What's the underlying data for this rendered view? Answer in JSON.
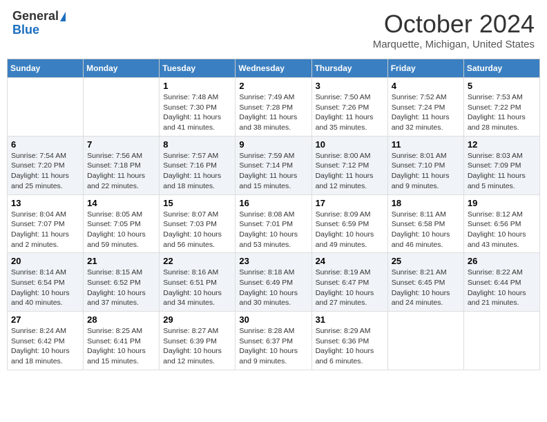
{
  "header": {
    "logo_general": "General",
    "logo_blue": "Blue",
    "month_title": "October 2024",
    "location": "Marquette, Michigan, United States"
  },
  "days_of_week": [
    "Sunday",
    "Monday",
    "Tuesday",
    "Wednesday",
    "Thursday",
    "Friday",
    "Saturday"
  ],
  "weeks": [
    [
      {
        "day": "",
        "info": ""
      },
      {
        "day": "",
        "info": ""
      },
      {
        "day": "1",
        "info": "Sunrise: 7:48 AM\nSunset: 7:30 PM\nDaylight: 11 hours and 41 minutes."
      },
      {
        "day": "2",
        "info": "Sunrise: 7:49 AM\nSunset: 7:28 PM\nDaylight: 11 hours and 38 minutes."
      },
      {
        "day": "3",
        "info": "Sunrise: 7:50 AM\nSunset: 7:26 PM\nDaylight: 11 hours and 35 minutes."
      },
      {
        "day": "4",
        "info": "Sunrise: 7:52 AM\nSunset: 7:24 PM\nDaylight: 11 hours and 32 minutes."
      },
      {
        "day": "5",
        "info": "Sunrise: 7:53 AM\nSunset: 7:22 PM\nDaylight: 11 hours and 28 minutes."
      }
    ],
    [
      {
        "day": "6",
        "info": "Sunrise: 7:54 AM\nSunset: 7:20 PM\nDaylight: 11 hours and 25 minutes."
      },
      {
        "day": "7",
        "info": "Sunrise: 7:56 AM\nSunset: 7:18 PM\nDaylight: 11 hours and 22 minutes."
      },
      {
        "day": "8",
        "info": "Sunrise: 7:57 AM\nSunset: 7:16 PM\nDaylight: 11 hours and 18 minutes."
      },
      {
        "day": "9",
        "info": "Sunrise: 7:59 AM\nSunset: 7:14 PM\nDaylight: 11 hours and 15 minutes."
      },
      {
        "day": "10",
        "info": "Sunrise: 8:00 AM\nSunset: 7:12 PM\nDaylight: 11 hours and 12 minutes."
      },
      {
        "day": "11",
        "info": "Sunrise: 8:01 AM\nSunset: 7:10 PM\nDaylight: 11 hours and 9 minutes."
      },
      {
        "day": "12",
        "info": "Sunrise: 8:03 AM\nSunset: 7:09 PM\nDaylight: 11 hours and 5 minutes."
      }
    ],
    [
      {
        "day": "13",
        "info": "Sunrise: 8:04 AM\nSunset: 7:07 PM\nDaylight: 11 hours and 2 minutes."
      },
      {
        "day": "14",
        "info": "Sunrise: 8:05 AM\nSunset: 7:05 PM\nDaylight: 10 hours and 59 minutes."
      },
      {
        "day": "15",
        "info": "Sunrise: 8:07 AM\nSunset: 7:03 PM\nDaylight: 10 hours and 56 minutes."
      },
      {
        "day": "16",
        "info": "Sunrise: 8:08 AM\nSunset: 7:01 PM\nDaylight: 10 hours and 53 minutes."
      },
      {
        "day": "17",
        "info": "Sunrise: 8:09 AM\nSunset: 6:59 PM\nDaylight: 10 hours and 49 minutes."
      },
      {
        "day": "18",
        "info": "Sunrise: 8:11 AM\nSunset: 6:58 PM\nDaylight: 10 hours and 46 minutes."
      },
      {
        "day": "19",
        "info": "Sunrise: 8:12 AM\nSunset: 6:56 PM\nDaylight: 10 hours and 43 minutes."
      }
    ],
    [
      {
        "day": "20",
        "info": "Sunrise: 8:14 AM\nSunset: 6:54 PM\nDaylight: 10 hours and 40 minutes."
      },
      {
        "day": "21",
        "info": "Sunrise: 8:15 AM\nSunset: 6:52 PM\nDaylight: 10 hours and 37 minutes."
      },
      {
        "day": "22",
        "info": "Sunrise: 8:16 AM\nSunset: 6:51 PM\nDaylight: 10 hours and 34 minutes."
      },
      {
        "day": "23",
        "info": "Sunrise: 8:18 AM\nSunset: 6:49 PM\nDaylight: 10 hours and 30 minutes."
      },
      {
        "day": "24",
        "info": "Sunrise: 8:19 AM\nSunset: 6:47 PM\nDaylight: 10 hours and 27 minutes."
      },
      {
        "day": "25",
        "info": "Sunrise: 8:21 AM\nSunset: 6:45 PM\nDaylight: 10 hours and 24 minutes."
      },
      {
        "day": "26",
        "info": "Sunrise: 8:22 AM\nSunset: 6:44 PM\nDaylight: 10 hours and 21 minutes."
      }
    ],
    [
      {
        "day": "27",
        "info": "Sunrise: 8:24 AM\nSunset: 6:42 PM\nDaylight: 10 hours and 18 minutes."
      },
      {
        "day": "28",
        "info": "Sunrise: 8:25 AM\nSunset: 6:41 PM\nDaylight: 10 hours and 15 minutes."
      },
      {
        "day": "29",
        "info": "Sunrise: 8:27 AM\nSunset: 6:39 PM\nDaylight: 10 hours and 12 minutes."
      },
      {
        "day": "30",
        "info": "Sunrise: 8:28 AM\nSunset: 6:37 PM\nDaylight: 10 hours and 9 minutes."
      },
      {
        "day": "31",
        "info": "Sunrise: 8:29 AM\nSunset: 6:36 PM\nDaylight: 10 hours and 6 minutes."
      },
      {
        "day": "",
        "info": ""
      },
      {
        "day": "",
        "info": ""
      }
    ]
  ]
}
